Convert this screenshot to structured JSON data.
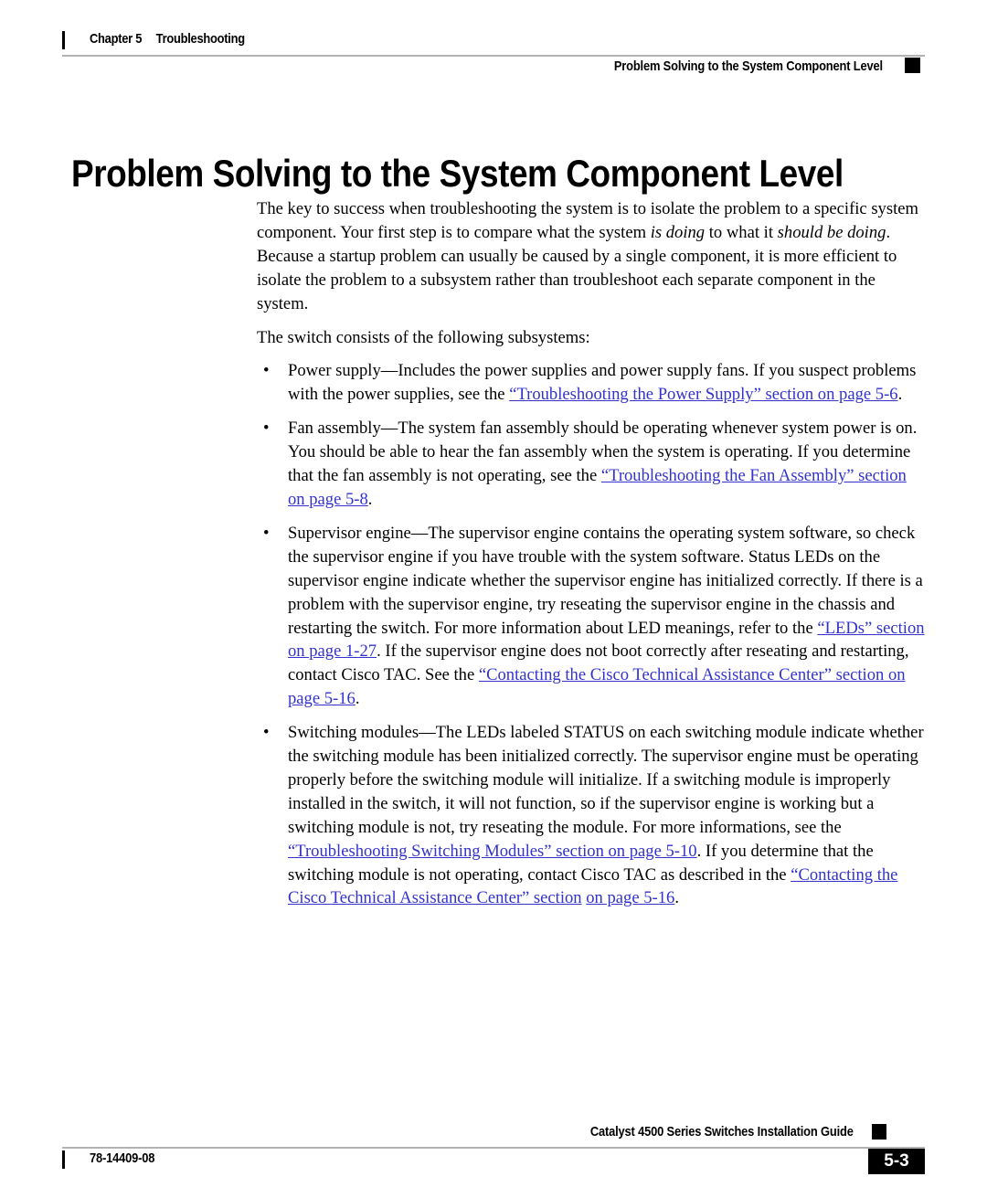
{
  "header": {
    "chapter": "Chapter 5",
    "chapter_title": "Troubleshooting",
    "section": "Problem Solving to the System Component Level"
  },
  "title": "Problem Solving to the System Component Level",
  "paragraphs": {
    "intro_1": "The key to success when troubleshooting the system is to isolate the problem to a specific system component. Your first step is to compare what the system ",
    "intro_1_ital_a": "is doing",
    "intro_1_mid": " to what it ",
    "intro_1_ital_b": "should be doing",
    "intro_1_end": ". Because a startup problem can usually be caused by a single component, it is more efficient to isolate the problem to a subsystem rather than troubleshoot each separate component in the system.",
    "intro_2": "The switch consists of the following subsystems:"
  },
  "bullets": [
    {
      "marker": "•",
      "text_1": "Power supply—Includes the power supplies and power supply fans. If you suspect problems with the power supplies, see the ",
      "link_1": "“Troubleshooting the Power Supply” section on page 5-6",
      "text_2": "."
    },
    {
      "marker": "•",
      "text_1": "Fan assembly—The system fan assembly should be operating whenever system power is on. You should be able to hear the fan assembly when the system is operating. If you determine that the fan assembly is not operating, see the ",
      "link_1": "“Troubleshooting the Fan Assembly” section on page 5-8",
      "text_2": "."
    },
    {
      "marker": "•",
      "text_1": "Supervisor engine—The supervisor engine contains the operating system software, so check the supervisor engine if you have trouble with the system software. Status LEDs on the supervisor engine indicate whether the supervisor engine has initialized correctly. If there is a problem with the supervisor engine, try reseating the supervisor engine in the chassis and restarting the switch. For more information about LED meanings, refer to the ",
      "link_1": "“LEDs” section on page 1-27",
      "text_2": ". If the supervisor engine does not boot correctly after reseating and restarting, contact Cisco TAC. See the ",
      "link_2": "“Contacting the Cisco Technical Assistance Center” section on page 5-16",
      "text_3": "."
    },
    {
      "marker": "•",
      "text_1": "Switching modules—The LEDs labeled STATUS on each switching module indicate whether the switching module has been initialized correctly. The supervisor engine must be operating properly before the switching module will initialize. If a switching module is improperly installed in the switch, it will not function, so if the supervisor engine is working but a switching module is not, try reseating the module. For more informations, see the ",
      "link_1": "“Troubleshooting Switching Modules” section on page 5-10",
      "text_2": ". If you determine that the switching module is not operating, contact Cisco TAC as described in the ",
      "link_2": "“Contacting the Cisco Technical Assistance Center” section",
      "text_3": " ",
      "link_3": "on page 5-16",
      "text_4": "."
    }
  ],
  "footer": {
    "guide_title": "Catalyst 4500 Series Switches Installation Guide",
    "doc_number": "78-14409-08",
    "page_number": "5-3"
  },
  "colors": {
    "link": "#3333cc",
    "rule": "#b3b3b3",
    "text": "#000000"
  }
}
